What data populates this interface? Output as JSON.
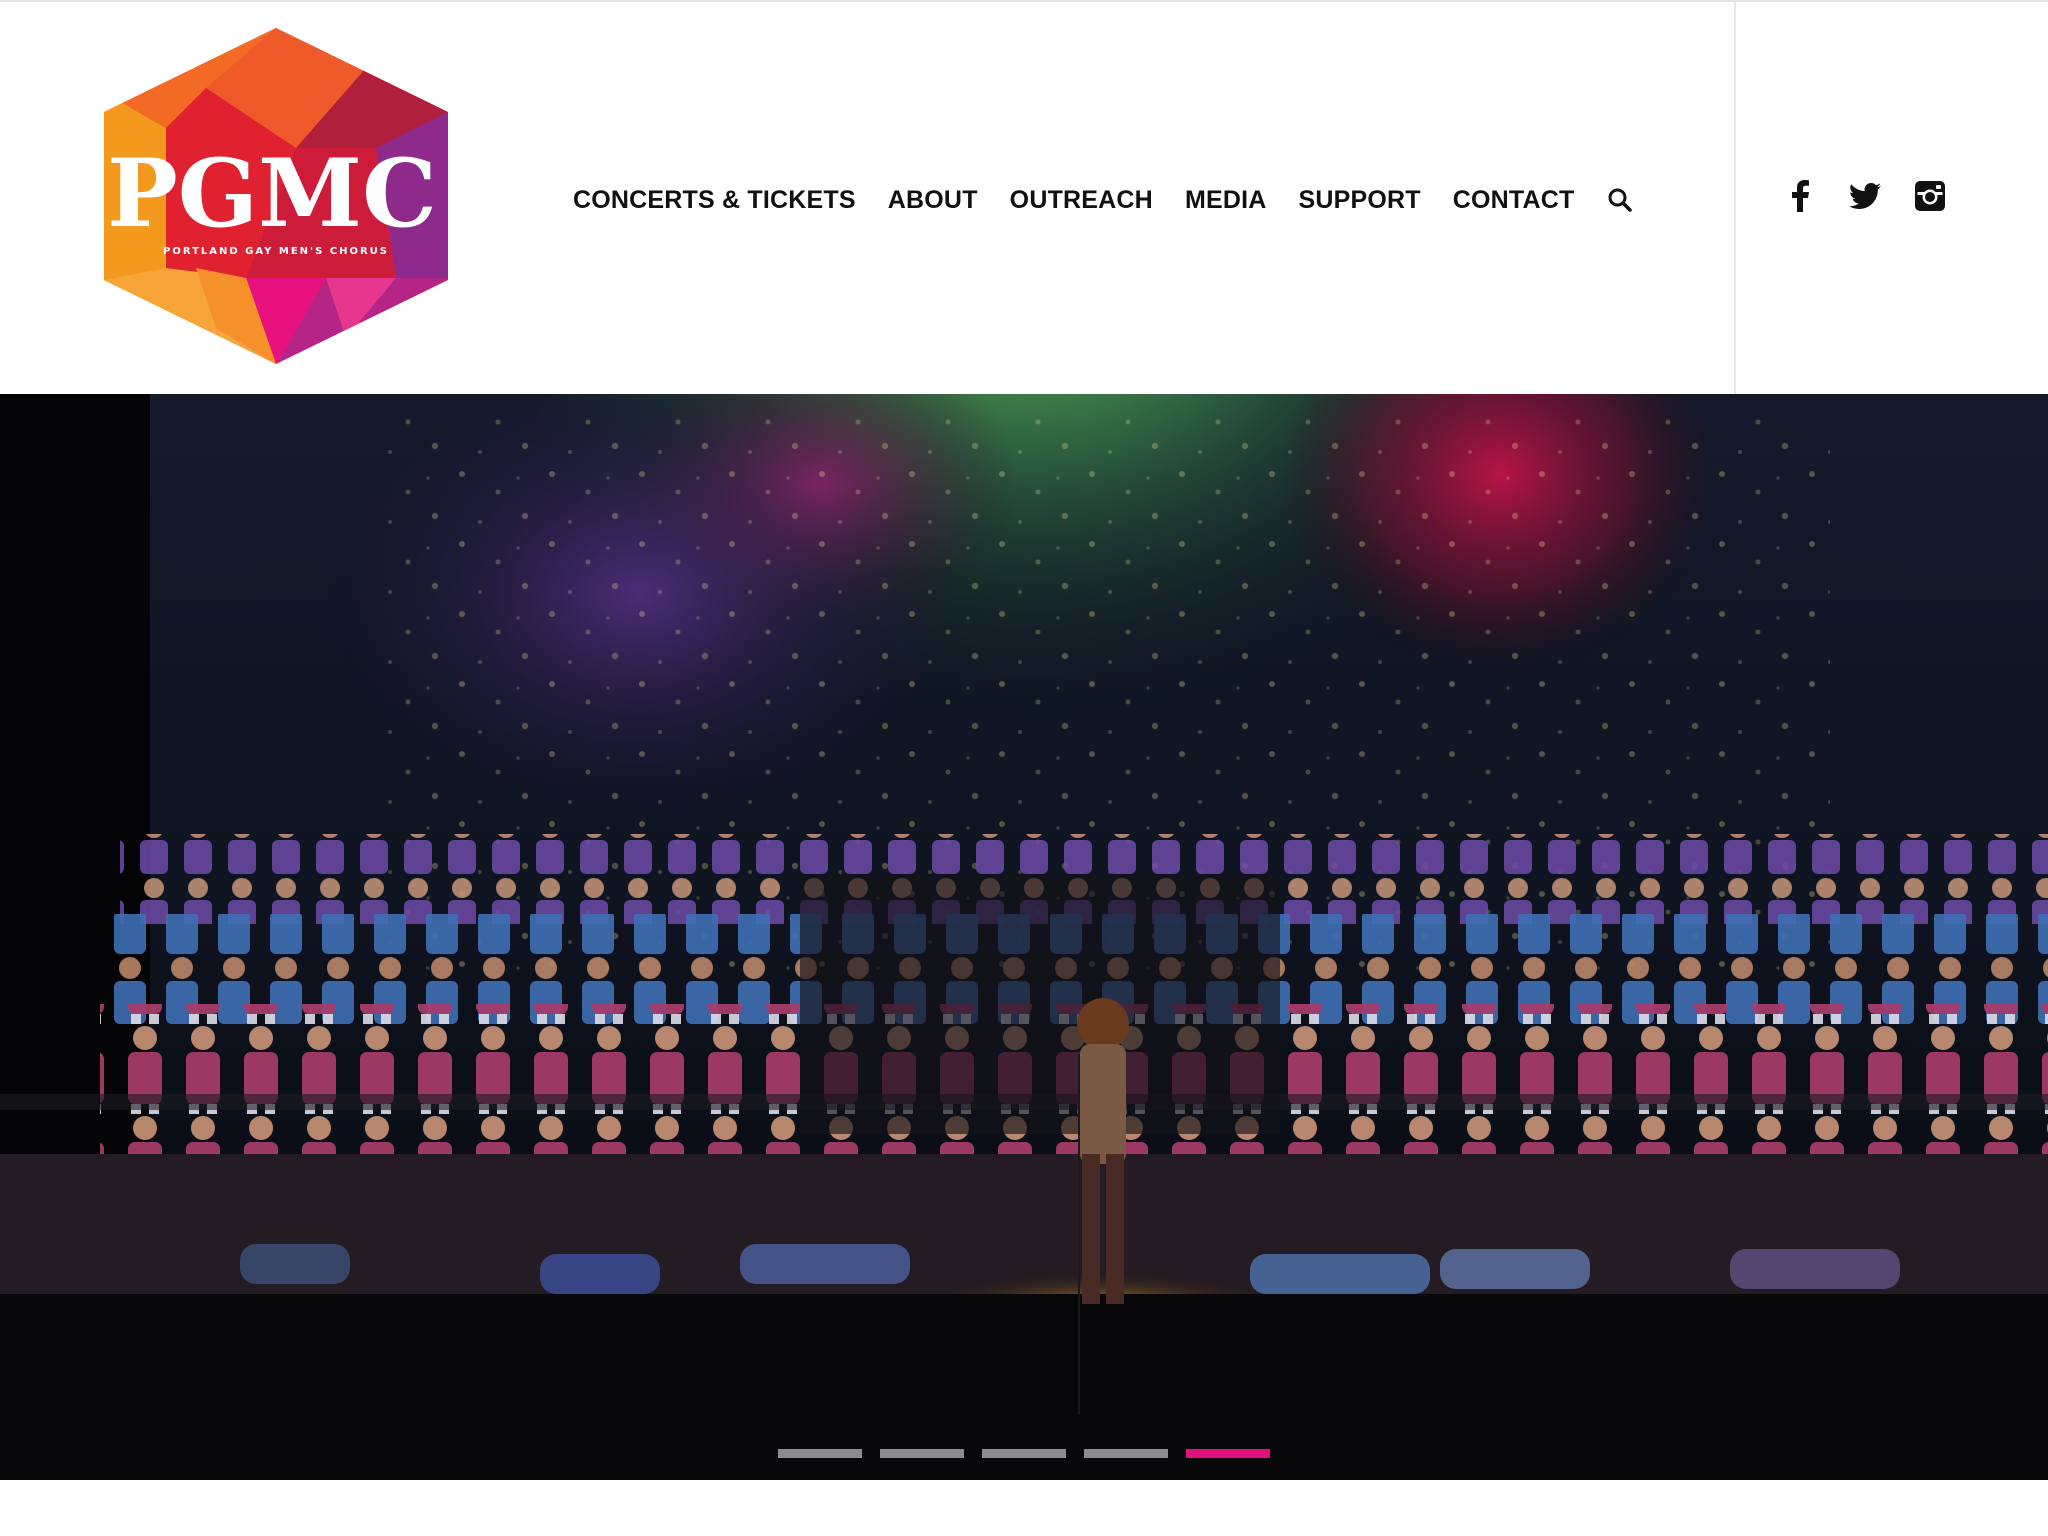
{
  "logo": {
    "wordmark": "PGMC",
    "subtitle": "PORTLAND GAY MEN'S CHORUS"
  },
  "nav": {
    "items": [
      {
        "label": "CONCERTS & TICKETS"
      },
      {
        "label": "ABOUT"
      },
      {
        "label": "OUTREACH"
      },
      {
        "label": "MEDIA"
      },
      {
        "label": "SUPPORT"
      },
      {
        "label": "CONTACT"
      }
    ],
    "search_icon": "search-icon"
  },
  "social": {
    "icons": [
      "facebook-icon",
      "twitter-icon",
      "instagram-icon"
    ]
  },
  "slider": {
    "slide_count": 5,
    "active_index": 5,
    "indicator_active_color": "#e0117c",
    "indicator_color": "#8c8c8c"
  },
  "colors": {
    "nav_text": "#111111",
    "logo_orange": "#f39a1e",
    "logo_red": "#e0212f",
    "logo_magenta": "#e0117c",
    "logo_purple": "#8e2a8c"
  }
}
